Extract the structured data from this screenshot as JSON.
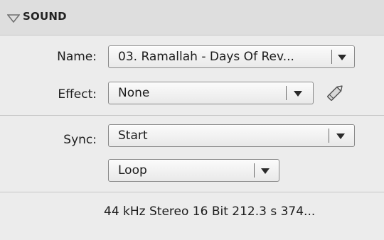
{
  "panel": {
    "section_title": "SOUND"
  },
  "name_field": {
    "label": "Name:",
    "value": "03. Ramallah - Days Of Rev..."
  },
  "effect_field": {
    "label": "Effect:",
    "value": "None"
  },
  "sync_field": {
    "label": "Sync:",
    "value": "Start"
  },
  "repeat_field": {
    "value": "Loop"
  },
  "sound_info": "44 kHz Stereo 16 Bit 212.3 s 374...",
  "icons": {
    "collapse": "triangle-down-outline",
    "edit": "pencil-icon",
    "dropdown": "chevron-down-icon"
  },
  "colors": {
    "panel_bg": "#ececec",
    "header_bg": "#dedede",
    "text": "#1c1c1c"
  }
}
